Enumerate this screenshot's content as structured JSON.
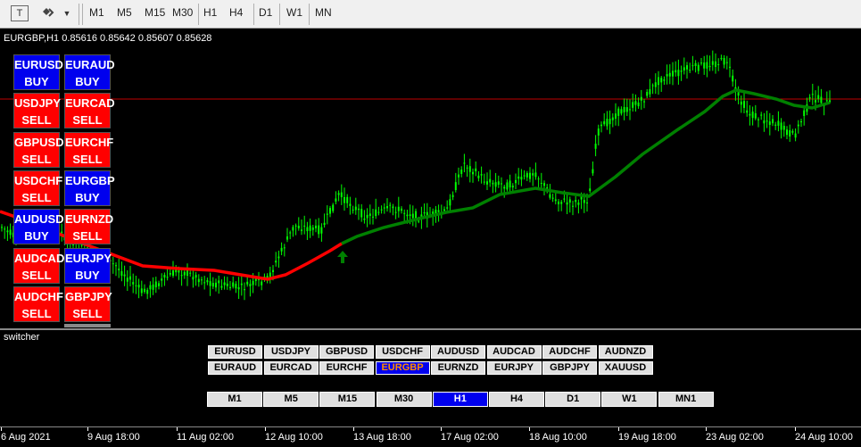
{
  "toolbar": {
    "timeframes": [
      "M1",
      "M5",
      "M15",
      "M30",
      "H1",
      "H4",
      "D1",
      "W1",
      "MN"
    ],
    "icons": [
      "text-icon",
      "shapes-icon",
      "dropdown-arrow-icon"
    ]
  },
  "chart": {
    "symbol_info": "EURGBP,H1  0.85616 0.85642 0.85607 0.85628",
    "pair_buttons": [
      {
        "pair": "EURUSD",
        "action": "BUY"
      },
      {
        "pair": "EURAUD",
        "action": "BUY"
      },
      {
        "pair": "USDJPY",
        "action": "SELL"
      },
      {
        "pair": "EURCAD",
        "action": "SELL"
      },
      {
        "pair": "GBPUSD",
        "action": "SELL"
      },
      {
        "pair": "EURCHF",
        "action": "SELL"
      },
      {
        "pair": "USDCHF",
        "action": "SELL"
      },
      {
        "pair": "EURGBP",
        "action": "BUY"
      },
      {
        "pair": "AUDUSD",
        "action": "BUY"
      },
      {
        "pair": "EURNZD",
        "action": "SELL"
      },
      {
        "pair": "AUDCAD",
        "action": "SELL"
      },
      {
        "pair": "EURJPY",
        "action": "BUY"
      },
      {
        "pair": "AUDCHF",
        "action": "SELL"
      },
      {
        "pair": "GBPJPY",
        "action": "SELL"
      }
    ],
    "colors": {
      "candles": "#00ff00",
      "ma_up": "#008000",
      "ma_down": "#ff0000",
      "price_line": "#c00000",
      "arrow": "#008000",
      "buy": "#0000ee",
      "sell": "#ff0000"
    }
  },
  "subwindow": {
    "title": "switcher",
    "symbols_row1": [
      "EURUSD",
      "USDJPY",
      "GBPUSD",
      "USDCHF",
      "AUDUSD",
      "AUDCAD",
      "AUDCHF",
      "AUDNZD"
    ],
    "symbols_row2": [
      "EURAUD",
      "EURCAD",
      "EURCHF",
      "EURGBP",
      "EURNZD",
      "EURJPY",
      "GBPJPY",
      "XAUUSD"
    ],
    "active_symbol": "EURGBP",
    "timeframes": [
      "M1",
      "M5",
      "M15",
      "M30",
      "H1",
      "H4",
      "D1",
      "W1",
      "MN1"
    ],
    "active_timeframe": "H1"
  },
  "time_axis": [
    "6 Aug 2021",
    "9 Aug 18:00",
    "11 Aug 02:00",
    "12 Aug 10:00",
    "13 Aug 18:00",
    "17 Aug 02:00",
    "18 Aug 10:00",
    "19 Aug 18:00",
    "23 Aug 02:00",
    "24 Aug 10:00"
  ]
}
